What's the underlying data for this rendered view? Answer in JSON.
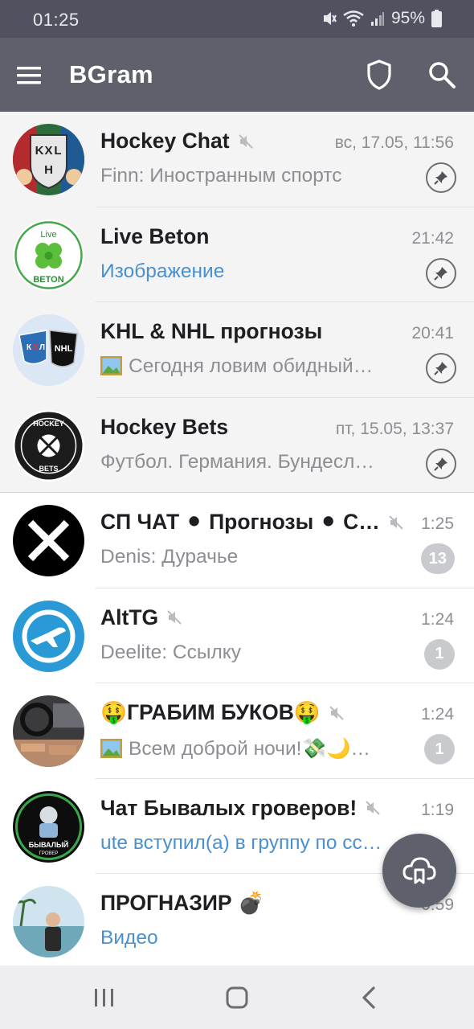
{
  "status_bar": {
    "time": "01:25",
    "battery": "95%"
  },
  "app_bar": {
    "title": "BGram"
  },
  "chats": [
    {
      "name": "Hockey Chat",
      "muted": true,
      "time": "вс, 17.05, 11:56",
      "sender": "Finn:",
      "preview": "Иностранным спортс",
      "pinned": true
    },
    {
      "name": "Live Beton",
      "muted": false,
      "time": "21:42",
      "preview": "Изображение",
      "pinned": true
    },
    {
      "name": "KHL & NHL прогнозы",
      "muted": false,
      "time": "20:41",
      "preview": "Сегодня ловим обидный…",
      "pinned": true
    },
    {
      "name": "Hockey Bets",
      "muted": false,
      "time": "пт, 15.05, 13:37",
      "preview": "Футбол. Германия. Бундесл…",
      "pinned": true
    },
    {
      "name": "СП ЧАТ ⚫ Прогнозы ⚫ С…",
      "muted": true,
      "time": "1:25",
      "sender": "Denis:",
      "preview": "Дурачье",
      "unread": "13"
    },
    {
      "name": "AltTG",
      "muted": true,
      "time": "1:24",
      "sender": "Deelite:",
      "preview": "Ссылку",
      "unread": "1"
    },
    {
      "name": "🤑ГРАБИМ БУКОВ🤑",
      "muted": true,
      "time": "1:24",
      "preview": "Всем доброй ночи!💸🌙…",
      "unread": "1"
    },
    {
      "name": "Чат Бывалых гроверов!",
      "muted": true,
      "time": "1:19",
      "preview": "ute вступил(а) в группу по ссылке"
    },
    {
      "name": "ПРОГНАЗИР 💣",
      "muted": false,
      "time": "0:59",
      "preview": "Видео"
    }
  ],
  "avatars": {
    "hockey_chat": [
      "K",
      "X",
      "L",
      "H"
    ],
    "live_beton": {
      "top": "Live",
      "bottom": "BETON"
    },
    "khl": [
      "К",
      "Х",
      "Л"
    ],
    "nhl": "NHL",
    "hockey_bets": {
      "top": "HOCKEY",
      "bottom": "BETS"
    },
    "grower": {
      "line1": "БЫВАЛЫЙ",
      "line2": "ГРОВЕР"
    }
  },
  "colors": {
    "status_bar": "#50535f",
    "app_bar": "#5e616c",
    "pinned_bg": "#f4f4f5",
    "link_blue": "#4a8fcf",
    "muted_text": "#8c8e93",
    "badge": "#c8cacd"
  },
  "icons": [
    "hamburger-menu-icon",
    "shield-icon",
    "search-icon",
    "mute-icon",
    "pin-icon",
    "cloud-bookmark-icon",
    "recents-icon",
    "home-icon",
    "back-icon"
  ]
}
